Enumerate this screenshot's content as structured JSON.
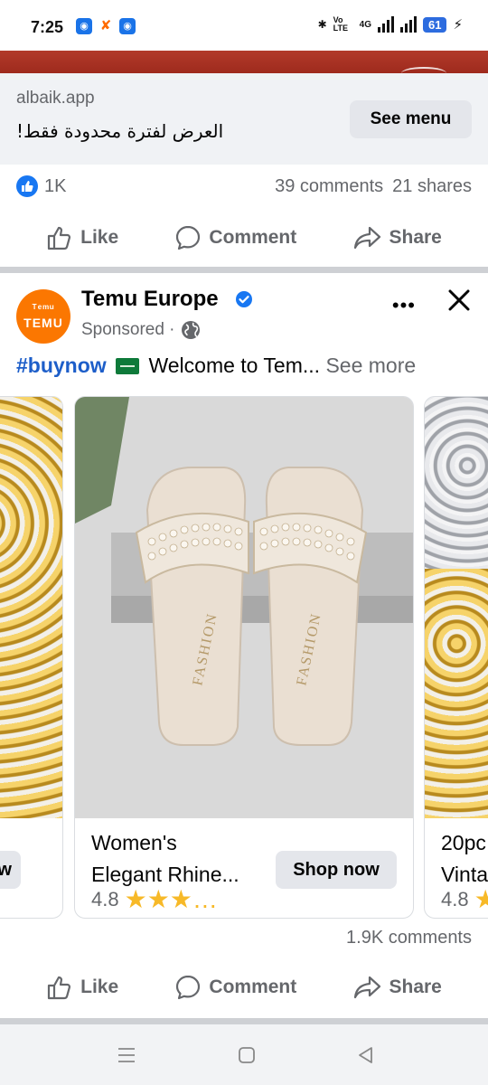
{
  "status_bar": {
    "time": "7:25",
    "network_label": "4G",
    "volte_label": "Vo LTE",
    "battery": "61"
  },
  "link_card": {
    "domain": "albaik.app",
    "title": "العرض لفترة محدودة فقط!",
    "cta": "See menu"
  },
  "post1_stats": {
    "reactions": "1K",
    "comments": "39 comments",
    "shares": "21 shares"
  },
  "actions": {
    "like": "Like",
    "comment": "Comment",
    "share": "Share"
  },
  "post2": {
    "page_name": "Temu Europe",
    "avatar_line1": "ᵀᵉᵐᵘ",
    "avatar_line2": "TEMU",
    "sponsored": "Sponsored ·",
    "hashtag": "#buynow",
    "text": "Welcome to Tem...",
    "see_more": "See more",
    "comments": "1.9K comments"
  },
  "carousel": [
    {
      "title_lines": [
        "",
        ""
      ],
      "cta": "Shop now",
      "cta_visible": "now",
      "rating": ""
    },
    {
      "title_lines": [
        "Women's",
        "Elegant Rhine..."
      ],
      "cta": "Shop now",
      "rating": "4.8",
      "stars": "★★★…"
    },
    {
      "title_lines": [
        "20pc",
        "Vinta"
      ],
      "cta": "",
      "rating": "4.8",
      "stars": "★"
    }
  ],
  "sandal_label": "FASHION",
  "colors": {
    "facebook_blue": "#1877f2",
    "temu_orange": "#fb7701",
    "muted_text": "#65676b",
    "button_bg": "#e4e6eb"
  }
}
